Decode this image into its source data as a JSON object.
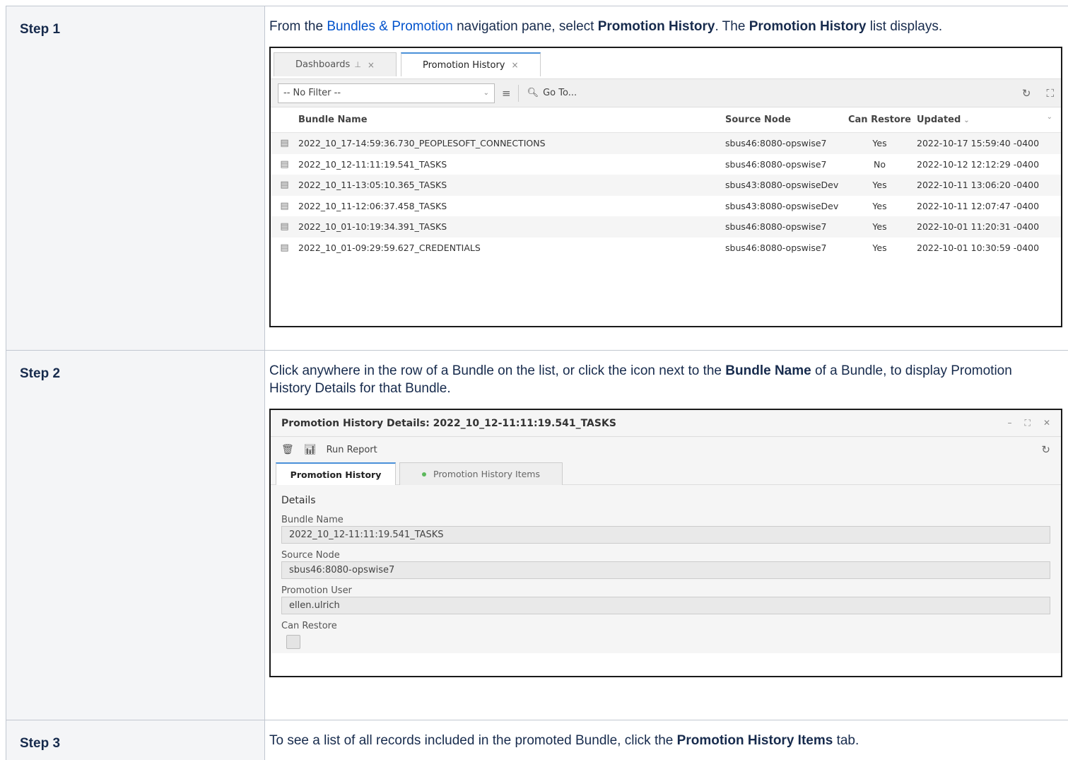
{
  "steps": {
    "step1": {
      "label": "Step 1",
      "text_pre": "From the ",
      "link": "Bundles & Promotion",
      "text_mid1": " navigation pane, select ",
      "bold1": "Promotion History",
      "text_mid2": ". The ",
      "bold2": "Promotion History",
      "text_post": " list displays."
    },
    "step2": {
      "label": "Step 2",
      "text_pre": "Click anywhere in the row of a Bundle on the list, or click the icon next to the ",
      "bold1": "Bundle Name",
      "text_post": " of a Bundle, to display Promotion History Details for that Bundle."
    },
    "step3": {
      "label": "Step 3",
      "text_pre": "To see a list of all records included in the promoted Bundle, click the ",
      "bold1": "Promotion History Items",
      "text_post": " tab."
    }
  },
  "list_view": {
    "tabs": [
      {
        "label": "Dashboards",
        "pin": "⊥",
        "close": "×"
      },
      {
        "label": "Promotion History",
        "close": "×"
      }
    ],
    "filter_value": "-- No Filter --",
    "goto_label": "Go To...",
    "columns": [
      "Bundle Name",
      "Source Node",
      "Can Restore",
      "Updated"
    ],
    "rows": [
      {
        "name": "2022_10_17-14:59:36.730_PEOPLESOFT_CONNECTIONS",
        "node": "sbus46:8080-opswise7",
        "restore": "Yes",
        "updated": "2022-10-17 15:59:40 -0400"
      },
      {
        "name": "2022_10_12-11:11:19.541_TASKS",
        "node": "sbus46:8080-opswise7",
        "restore": "No",
        "updated": "2022-10-12 12:12:29 -0400"
      },
      {
        "name": "2022_10_11-13:05:10.365_TASKS",
        "node": "sbus43:8080-opswiseDev",
        "restore": "Yes",
        "updated": "2022-10-11 13:06:20 -0400"
      },
      {
        "name": "2022_10_11-12:06:37.458_TASKS",
        "node": "sbus43:8080-opswiseDev",
        "restore": "Yes",
        "updated": "2022-10-11 12:07:47 -0400"
      },
      {
        "name": "2022_10_01-10:19:34.391_TASKS",
        "node": "sbus46:8080-opswise7",
        "restore": "Yes",
        "updated": "2022-10-01 11:20:31 -0400"
      },
      {
        "name": "2022_10_01-09:29:59.627_CREDENTIALS",
        "node": "sbus46:8080-opswise7",
        "restore": "Yes",
        "updated": "2022-10-01 10:30:59 -0400"
      }
    ]
  },
  "details_view": {
    "title": "Promotion History Details: 2022_10_12-11:11:19.541_TASKS",
    "run_report": "Run Report",
    "tabs": [
      "Promotion History",
      "Promotion History Items"
    ],
    "section": "Details",
    "fields": {
      "bundle_name_label": "Bundle Name",
      "bundle_name_value": "2022_10_12-11:11:19.541_TASKS",
      "source_node_label": "Source Node",
      "source_node_value": "sbus46:8080-opswise7",
      "promotion_user_label": "Promotion User",
      "promotion_user_value": "ellen.ulrich",
      "can_restore_label": "Can Restore"
    }
  }
}
